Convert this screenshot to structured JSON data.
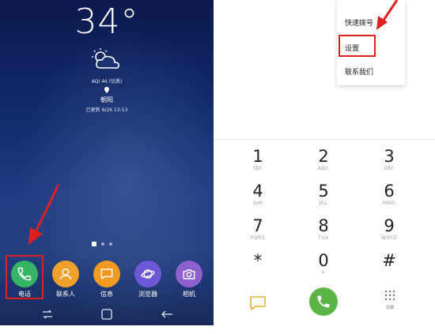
{
  "home": {
    "temperature": "34°",
    "aqi": "AQI 46 (优质)",
    "city": "朝阳",
    "updated": "已更新 6/26 13:53",
    "dock": [
      {
        "label": "电话",
        "color": "#35b463",
        "icon": "phone-icon"
      },
      {
        "label": "联系人",
        "color": "#f1a12a",
        "icon": "contacts-icon"
      },
      {
        "label": "信息",
        "color": "#f29a1f",
        "icon": "message-icon"
      },
      {
        "label": "浏览器",
        "color": "#6c58d6",
        "icon": "browser-icon"
      },
      {
        "label": "相机",
        "color": "#8e5fcf",
        "icon": "camera-icon"
      }
    ]
  },
  "menu": {
    "speed_dial": "快速拨号",
    "settings": "设置",
    "contact_us": "联系我们"
  },
  "dialpad": [
    {
      "digit": "1",
      "letters": "QD"
    },
    {
      "digit": "2",
      "letters": "ABC"
    },
    {
      "digit": "3",
      "letters": "DEF"
    },
    {
      "digit": "4",
      "letters": "GHI"
    },
    {
      "digit": "5",
      "letters": "JKL"
    },
    {
      "digit": "6",
      "letters": "MNO"
    },
    {
      "digit": "7",
      "letters": "PQRS"
    },
    {
      "digit": "8",
      "letters": "TUV"
    },
    {
      "digit": "9",
      "letters": "WXYZ"
    },
    {
      "digit": "*",
      "letters": ""
    },
    {
      "digit": "0",
      "letters": "+"
    },
    {
      "digit": "#",
      "letters": ""
    }
  ],
  "dialer_bottom": {
    "hide_label": "隐藏"
  },
  "colors": {
    "highlight": "#e02020",
    "call_green": "#5ab546"
  }
}
